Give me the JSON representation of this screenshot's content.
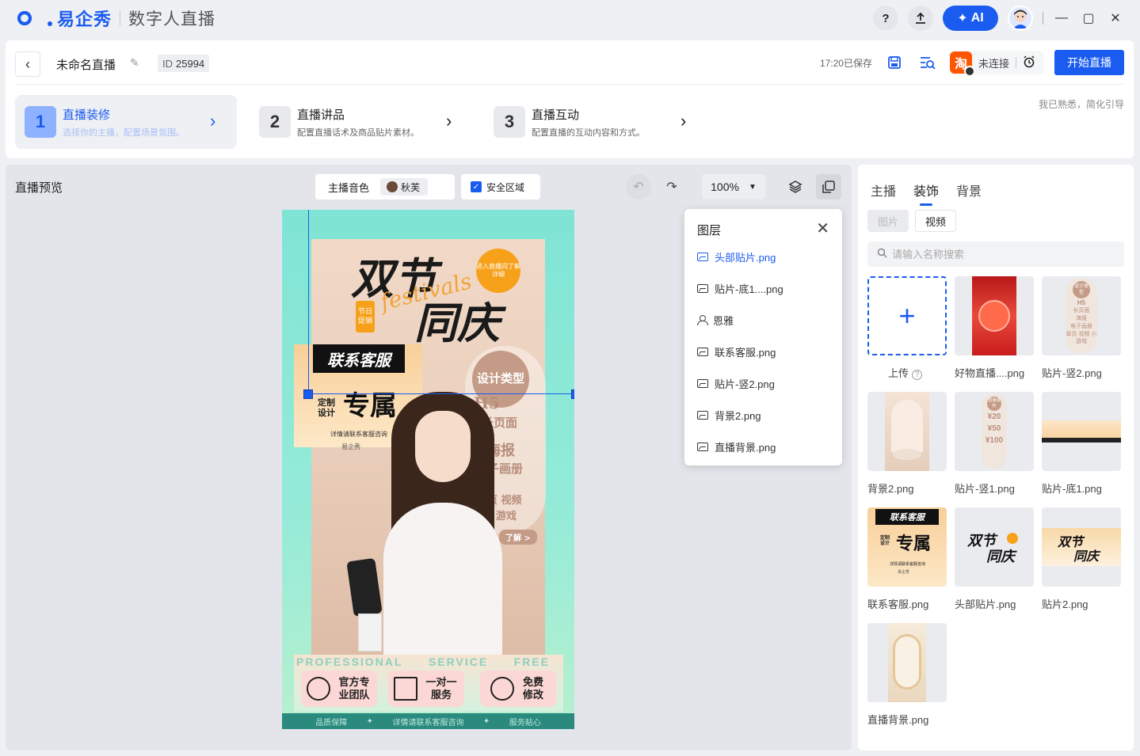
{
  "app": {
    "logo_text": "易企秀",
    "title": "数字人直播",
    "help_label": "?",
    "ai_label": "AI"
  },
  "header": {
    "back_label": "‹",
    "doc_name": "未命名直播",
    "id_label": "ID",
    "id_value": "25994",
    "saved_status": "17:20已保存",
    "taobao_label": "淘",
    "connection_status": "未连接",
    "start_button": "开始直播"
  },
  "steps": [
    {
      "num": "1",
      "title": "直播装修",
      "desc": "选择你的主播，配置场景氛围。"
    },
    {
      "num": "2",
      "title": "直播讲品",
      "desc": "配置直播话术及商品贴片素材。"
    },
    {
      "num": "3",
      "title": "直播互动",
      "desc": "配置直播的互动内容和方式。"
    }
  ],
  "familiar_link": "我已熟悉，简化引导",
  "preview": {
    "label": "直播预览",
    "voice_label": "主播音色",
    "voice_name": "秋芙",
    "safe_area_label": "安全区域",
    "zoom": "100%"
  },
  "poster": {
    "title_line1": "双节",
    "title_line2": "同庆",
    "script_text": "festivals",
    "burst_text": "进入直播间了解详细",
    "tag_text": "节日促销",
    "service_banner": "联系客服",
    "exclusive": "专属",
    "custom_design": "定制设计",
    "service_note": "详情请联系客服咨询",
    "brand": "易企秀",
    "design_type": "设计类型",
    "pill_h5": "H5",
    "pill_longpage": "长页面",
    "pill_poster": "海报",
    "pill_album": "电子画册",
    "pill_misc": "单页 视频",
    "pill_game": "游戏",
    "pill_more": "了解 >",
    "banner_words": [
      "PROFESSIONAL",
      "SERVICE",
      "FREE"
    ],
    "perks": [
      "官方专业团队",
      "一对一服务",
      "免费修改"
    ],
    "footer_items": [
      "品质保障",
      "详情请联系客服咨询",
      "服务贴心"
    ]
  },
  "layers": {
    "title": "图层",
    "items": [
      {
        "name": "头部贴片.png",
        "type": "image",
        "active": true
      },
      {
        "name": "贴片-底1....png",
        "type": "image",
        "active": false
      },
      {
        "name": "恩雅",
        "type": "person",
        "active": false
      },
      {
        "name": "联系客服.png",
        "type": "image",
        "active": false
      },
      {
        "name": "贴片-竖2.png",
        "type": "image",
        "active": false
      },
      {
        "name": "背景2.png",
        "type": "image",
        "active": false
      },
      {
        "name": "直播背景.png",
        "type": "image",
        "active": false
      }
    ]
  },
  "right_panel": {
    "tabs": [
      "主播",
      "装饰",
      "背景"
    ],
    "active_tab": "装饰",
    "sub_tabs": [
      "图片",
      "视频"
    ],
    "search_placeholder": "请输入名称搜索",
    "upload_label": "上传",
    "assets": [
      {
        "label": "好物直播....png"
      },
      {
        "label": "贴片-竖2.png"
      },
      {
        "label": "背景2.png"
      },
      {
        "label": "贴片-竖1.png"
      },
      {
        "label": "贴片-底1.png"
      },
      {
        "label": "联系客服.png"
      },
      {
        "label": "头部贴片.png"
      },
      {
        "label": "贴片2.png"
      },
      {
        "label": "直播背景.png"
      }
    ]
  },
  "thumbs": {
    "t2_top": "设计类型",
    "t2_h5": "H5",
    "t2_line": "长页面",
    "t2_poster": "海报",
    "t2_album": "电子画册",
    "t2_foot": "单页 视频 小游戏",
    "t4_top": "直播福利",
    "t4_v1": "¥20",
    "t4_v2": "¥50",
    "t4_v3": "¥100",
    "t6_banner": "联系客服",
    "t6_small": "定制设计",
    "t6_exc": "专属",
    "t6_note": "详情请联系客服咨询",
    "t6_brand": "易企秀",
    "t7_line1": "双节",
    "t7_line2": "同庆",
    "t8_line1": "双节",
    "t8_line2": "同庆"
  }
}
